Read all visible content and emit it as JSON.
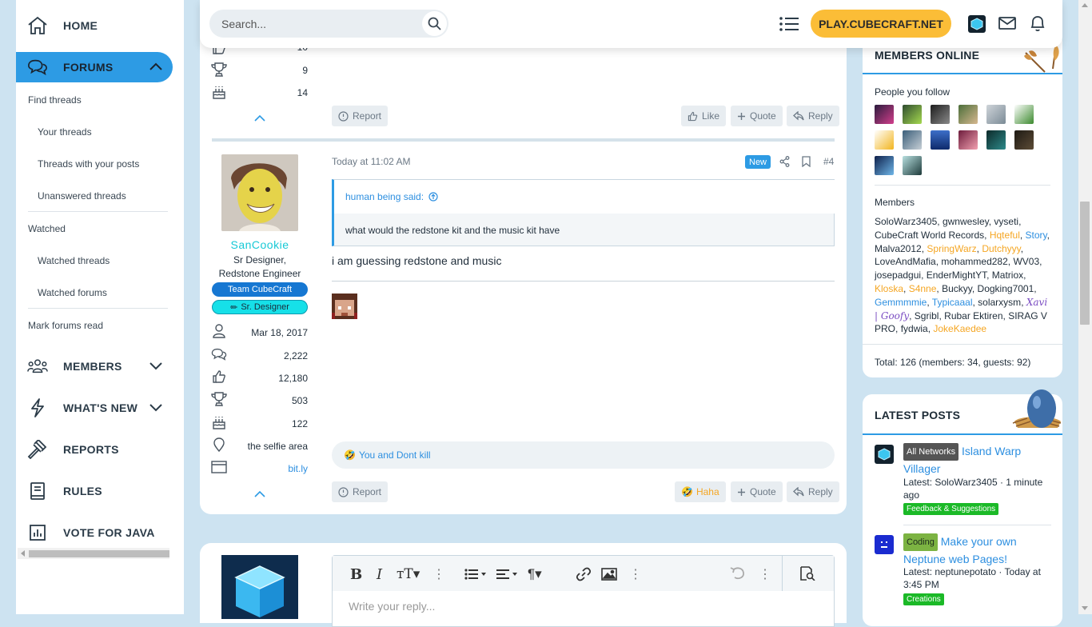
{
  "sidebar": {
    "home": "HOME",
    "forums": "FORUMS",
    "find_threads": "Find threads",
    "your_threads": "Your threads",
    "threads_with_posts": "Threads with your posts",
    "unanswered": "Unanswered threads",
    "watched": "Watched",
    "watched_threads": "Watched threads",
    "watched_forums": "Watched forums",
    "mark_read": "Mark forums read",
    "members": "MEMBERS",
    "whats_new": "WHAT'S NEW",
    "reports": "REPORTS",
    "rules": "RULES",
    "vote": "VOTE FOR JAVA"
  },
  "topbar": {
    "search_placeholder": "Search...",
    "play": "PLAY.CUBECRAFT.NET"
  },
  "prev_post": {
    "stat_partial": "10",
    "trophies": "9",
    "age": "14",
    "report": "Report",
    "like": "Like",
    "quote": "Quote",
    "reply": "Reply"
  },
  "post": {
    "username": "SanCookie",
    "user_title": "Sr Designer, Redstone Engineer",
    "banner_team": "Team CubeCraft",
    "banner_designer": "Sr. Designer",
    "joined": "Mar 18, 2017",
    "messages": "2,222",
    "reactions": "12,180",
    "points": "503",
    "age": "122",
    "location": "the selfie area",
    "website": "bit.ly",
    "time": "Today at 11:02 AM",
    "new_badge": "New",
    "post_number": "#4",
    "quote_author": "human being said:",
    "quote_text": "what would the redstone kit and the music kit have",
    "body": "i am guessing redstone and music",
    "reactions_line": "You and Dont kill",
    "report": "Report",
    "haha": "Haha",
    "quote": "Quote",
    "reply": "Reply"
  },
  "editor": {
    "placeholder": "Write your reply..."
  },
  "members_online": {
    "title": "MEMBERS ONLINE",
    "people_you_follow": "People you follow",
    "members_label": "Members",
    "list": [
      {
        "name": "SoloWarz3405",
        "color": "default"
      },
      {
        "name": "gwnwesley",
        "color": "default"
      },
      {
        "name": "vyseti",
        "color": "default"
      },
      {
        "name": "CubeCraft World Records",
        "color": "default"
      },
      {
        "name": "Hqteful",
        "color": "orange"
      },
      {
        "name": "Story",
        "color": "blue"
      },
      {
        "name": "Malva2012",
        "color": "default"
      },
      {
        "name": "SpringWarz",
        "color": "orange"
      },
      {
        "name": "Dutchyyy",
        "color": "orange"
      },
      {
        "name": "LoveAndMafia",
        "color": "default"
      },
      {
        "name": "mohammed282",
        "color": "default"
      },
      {
        "name": "WV03",
        "color": "default"
      },
      {
        "name": "josepadgui",
        "color": "default"
      },
      {
        "name": "EnderMightYT",
        "color": "default"
      },
      {
        "name": "Matriox",
        "color": "default"
      },
      {
        "name": "Kloska",
        "color": "orange"
      },
      {
        "name": "S4nne",
        "color": "orange"
      },
      {
        "name": "Buckyy",
        "color": "default"
      },
      {
        "name": "Dogking7001",
        "color": "default"
      },
      {
        "name": "Gemmmmie",
        "color": "blue"
      },
      {
        "name": "Typicaaal",
        "color": "blue"
      },
      {
        "name": "solarxysm",
        "color": "default"
      },
      {
        "name": "Xavi | Goofy",
        "color": "purple"
      },
      {
        "name": "Sgribl",
        "color": "default"
      },
      {
        "name": "Rubar Ektiren",
        "color": "default"
      },
      {
        "name": "SIRAG V PRO",
        "color": "default"
      },
      {
        "name": "fydwia",
        "color": "default"
      },
      {
        "name": "JokeKaedee",
        "color": "orange"
      }
    ],
    "total": "Total: 126 (members: 34, guests: 92)"
  },
  "latest_posts": {
    "title": "LATEST POSTS",
    "items": [
      {
        "prefix": "All Networks",
        "title": "Island Warp Villager",
        "meta": "Latest: SoloWarz3405 · 1 minute ago",
        "forum": "Feedback & Suggestions"
      },
      {
        "prefix": "Coding",
        "title": "Make your own Neptune web Pages!",
        "meta": "Latest: neptunepotato · Today at 3:45 PM",
        "forum": "Creations"
      }
    ]
  },
  "colors": {
    "accent": "#2d9be4",
    "play": "#fbbd37",
    "team_badge": "#1677d2",
    "designer_badge": "#16e0e8",
    "username": "#17c9d6"
  }
}
